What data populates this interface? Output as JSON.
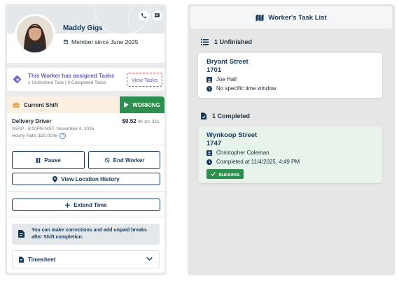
{
  "profile": {
    "name": "Maddy Gigs",
    "member_since": "Member since June 2025"
  },
  "assigned": {
    "title": "This Worker has assigned Tasks",
    "subtitle": "1 Unfinished Task | 0 Completed Tasks",
    "view_tasks_label": "View Tasks"
  },
  "shift": {
    "header_label": "Current Shift",
    "status_label": "WORKING",
    "role": "Delivery Driver",
    "pay": "$0.52",
    "elapsed": "0h 1m 33s",
    "window": "ASAP - 8:00PM MST, November 4, 2025",
    "hourly_rate": "Hourly Rate: $20.00/hr",
    "pause_label": "Pause",
    "end_worker_label": "End Worker",
    "view_location_label": "View Location History",
    "extend_time_label": "Extend Time",
    "notice_text": "You can make corrections and add unpaid breaks after Shift completion.",
    "timesheet_label": "Timesheet"
  },
  "task_list": {
    "title": "Worker's Task List",
    "unfinished_title": "1 Unfinished",
    "completed_title": "1 Completed",
    "unfinished": [
      {
        "street": "Bryant Street",
        "number": "1701",
        "person": "Joe Hall",
        "time": "No specific time window"
      }
    ],
    "completed": [
      {
        "street": "Wynkoop Street",
        "number": "1747",
        "person": "Christopher Coleman",
        "time": "Completed at 11/4/2025, 4:49 PM",
        "status": "Success"
      }
    ]
  },
  "colors": {
    "navy": "#14385a",
    "green": "#2d8f4e",
    "purple": "#6e57b8",
    "completed_card_bg": "#e8f3ec"
  }
}
